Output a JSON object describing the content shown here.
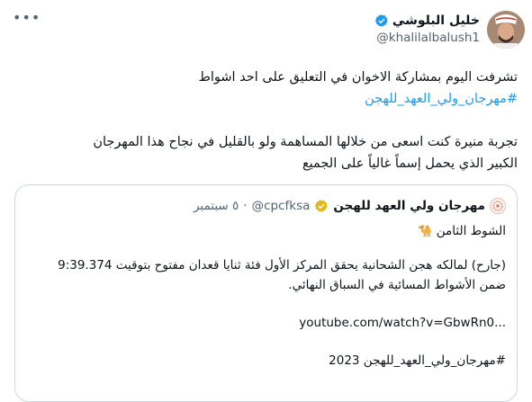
{
  "tweet": {
    "author": {
      "name": "خليل البلوشي",
      "handle": "@khalilalbalush1"
    },
    "more_icon": "more-icon",
    "line1": "تشرفت اليوم بمشاركة الاخوان في التعليق على احد اشواط",
    "hashtag1": "#مهرجان_ولي_العهد_للهجن",
    "line2": "تجربة منيرة كنت اسعى من خلالها المساهمة ولو بالقليل في نجاح هذا المهرجان",
    "line3": "الكبير الذي يحمل إسماً غالياً على الجميع"
  },
  "quote": {
    "name": "مهرجان ولي العهد للهجن",
    "handle": "@cpcfksa",
    "separator": "·",
    "date": "٥ سبتمبر",
    "line1": "الشوط الثامن",
    "emoji": "🐪",
    "line2": "(جارح) لمالكه هجن الشحانية يحقق المركز الأول فئة ثنايا قعدان مفتوح بتوقيت 9:39.374",
    "line3": "ضمن الأشواط المسائية في السباق النهائي.",
    "link": "youtube.com/watch?v=GbwRn0...",
    "hashtag": "#مهرجان_ولي_العهد_للهجن 2023"
  },
  "colors": {
    "link": "#1d9bf0",
    "text": "#0f1419",
    "muted": "#536471",
    "verified_blue": "#1d9bf0",
    "verified_gold": "#e2b719"
  }
}
